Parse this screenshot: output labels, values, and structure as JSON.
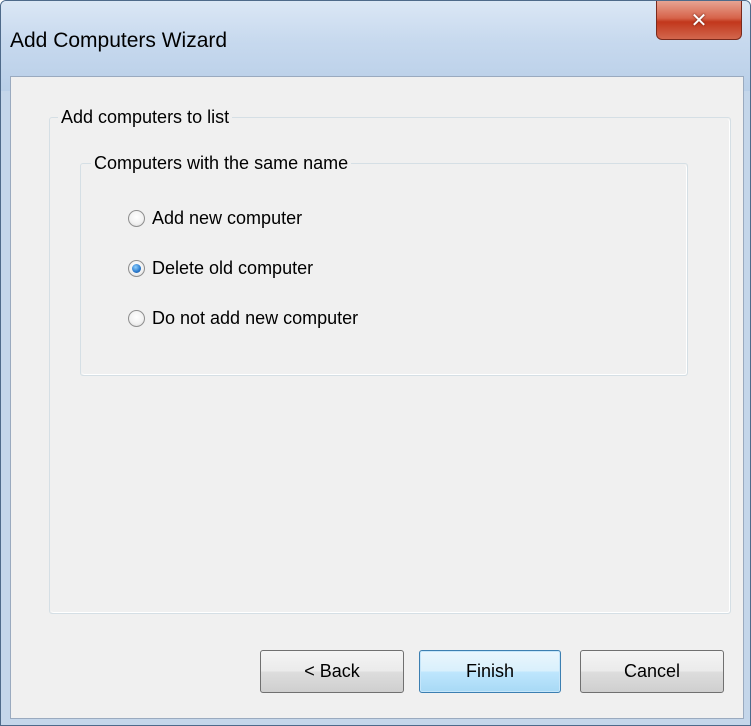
{
  "window": {
    "title": "Add Computers Wizard",
    "close_glyph": "✕"
  },
  "outer_group": {
    "legend": "Add computers to list"
  },
  "inner_group": {
    "legend": "Computers  with the same name",
    "options": [
      {
        "label": "Add new computer",
        "checked": false
      },
      {
        "label": "Delete old computer",
        "checked": true
      },
      {
        "label": "Do not add new computer",
        "checked": false
      }
    ]
  },
  "buttons": {
    "back_label": "< Back",
    "finish_label": "Finish",
    "cancel_label": "Cancel"
  },
  "colors": {
    "accent": "#3c7fb1",
    "close": "#c2371c"
  }
}
